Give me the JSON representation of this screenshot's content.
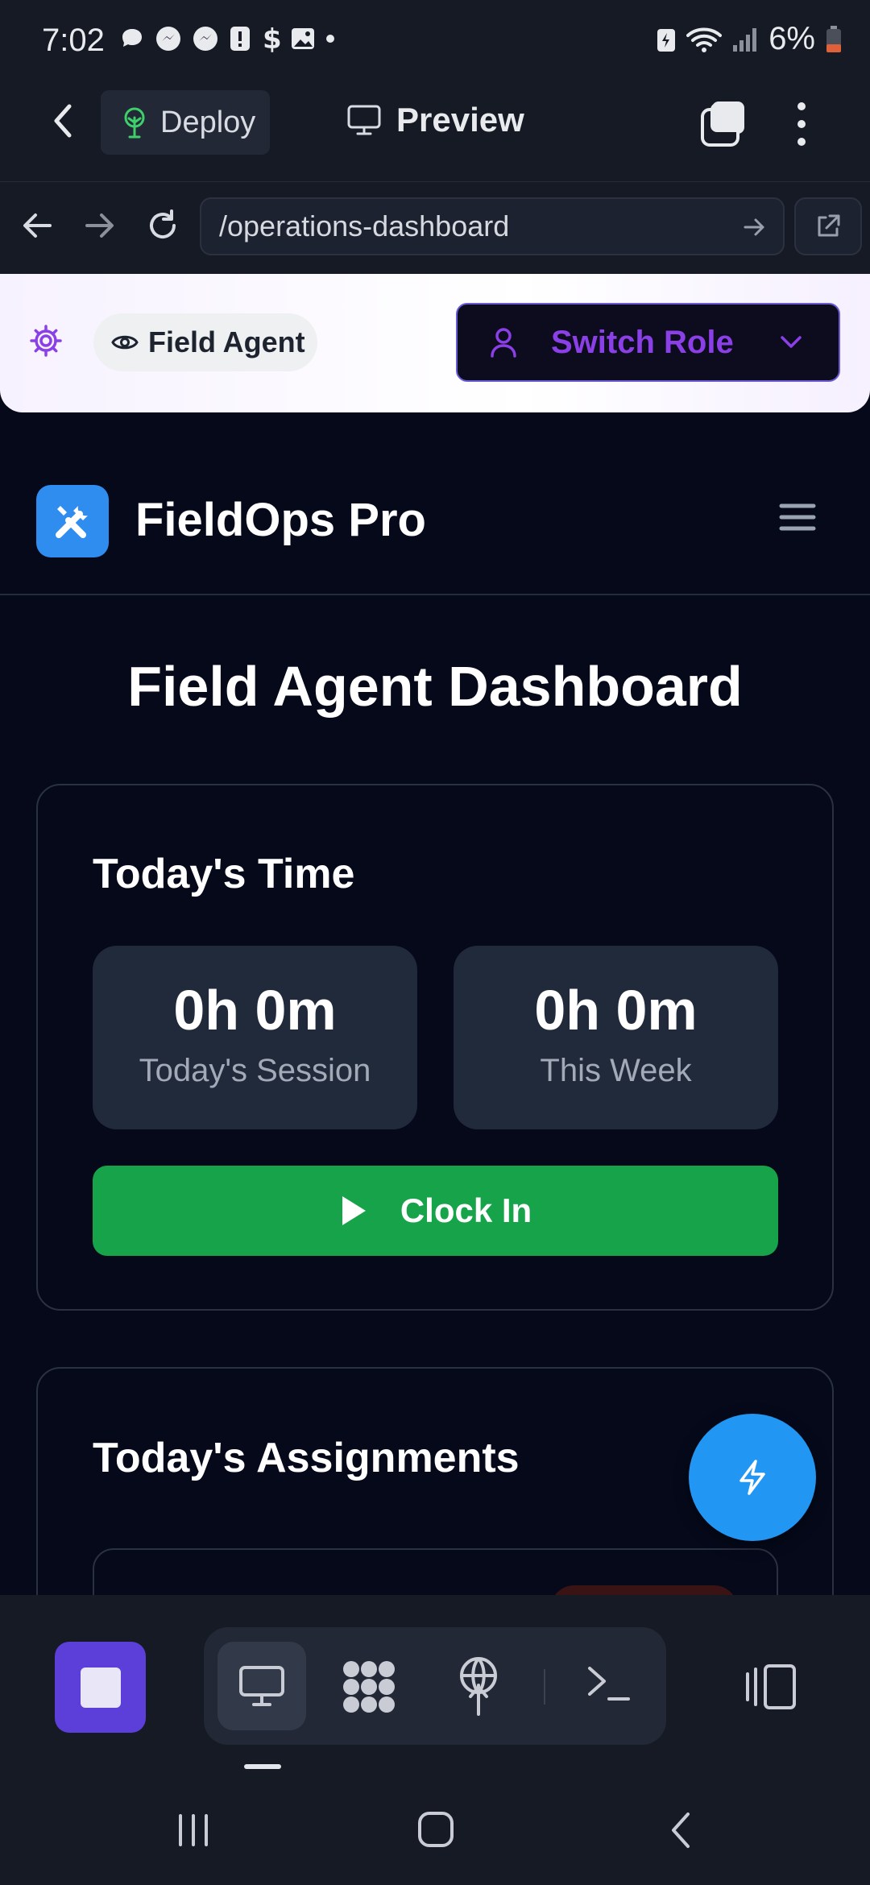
{
  "status_bar": {
    "time": "7:02",
    "battery": "6%"
  },
  "browser": {
    "deploy_label": "Deploy",
    "preview_label": "Preview",
    "url": "/operations-dashboard"
  },
  "role_bar": {
    "current_role": "Field Agent",
    "switch_label": "Switch Role"
  },
  "app": {
    "name": "FieldOps Pro",
    "dashboard_title": "Field Agent Dashboard"
  },
  "time_card": {
    "title": "Today's Time",
    "stats": [
      {
        "value": "0h 0m",
        "label": "Today's Session"
      },
      {
        "value": "0h 0m",
        "label": "This Week"
      }
    ],
    "clock_in_label": "Clock In"
  },
  "assignments_card": {
    "title": "Today's Assignments"
  },
  "colors": {
    "accent_blue": "#2f8df0",
    "clock_green": "#17a34a",
    "role_purple": "#8b3fe6",
    "stop_purple": "#5b3fd8",
    "fab_blue": "#2196f3"
  },
  "icons": {
    "deploy": "sprout-icon",
    "preview": "monitor-icon",
    "role_view": "eye-icon",
    "role_settings": "gear-icon",
    "switch_user": "user-icon",
    "logo": "tools-icon",
    "menu": "hamburger-icon",
    "clock_in": "play-icon",
    "fab": "lightning-icon"
  }
}
